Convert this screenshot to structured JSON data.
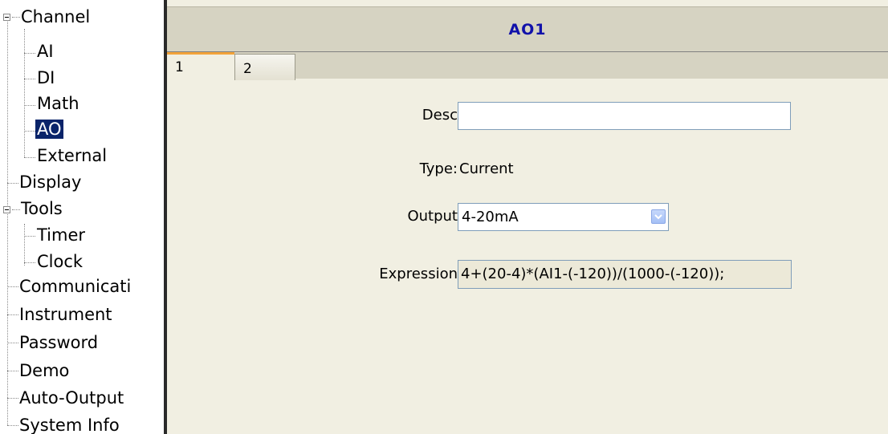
{
  "tree": {
    "items": [
      {
        "label": "Channel"
      },
      {
        "label": "AI"
      },
      {
        "label": "DI"
      },
      {
        "label": "Math"
      },
      {
        "label": "AO",
        "selected": true
      },
      {
        "label": "External"
      },
      {
        "label": "Display"
      },
      {
        "label": "Tools"
      },
      {
        "label": "Timer"
      },
      {
        "label": "Clock"
      },
      {
        "label": "Communicati"
      },
      {
        "label": "Instrument"
      },
      {
        "label": "Password"
      },
      {
        "label": "Demo"
      },
      {
        "label": "Auto-Output"
      },
      {
        "label": "System Info"
      }
    ],
    "selection_color": "#0a246a"
  },
  "panel": {
    "title": "AO1",
    "tabs": [
      {
        "label": "1",
        "active": true
      },
      {
        "label": "2",
        "active": false
      }
    ],
    "form": {
      "desc_label": "Desc",
      "desc_value": "",
      "type_label": "Type:",
      "type_value": "Current",
      "output_label": "Output",
      "output_value": "4-20mA",
      "expression_label": "Expression",
      "expression_value": "4+(20-4)*(AI1-(-120))/(1000-(-120));"
    },
    "colors": {
      "title_text": "#1111aa",
      "header_bg": "#d6d3c2",
      "panel_bg": "#f1efe2",
      "active_tab_accent": "#f2a33a"
    }
  }
}
